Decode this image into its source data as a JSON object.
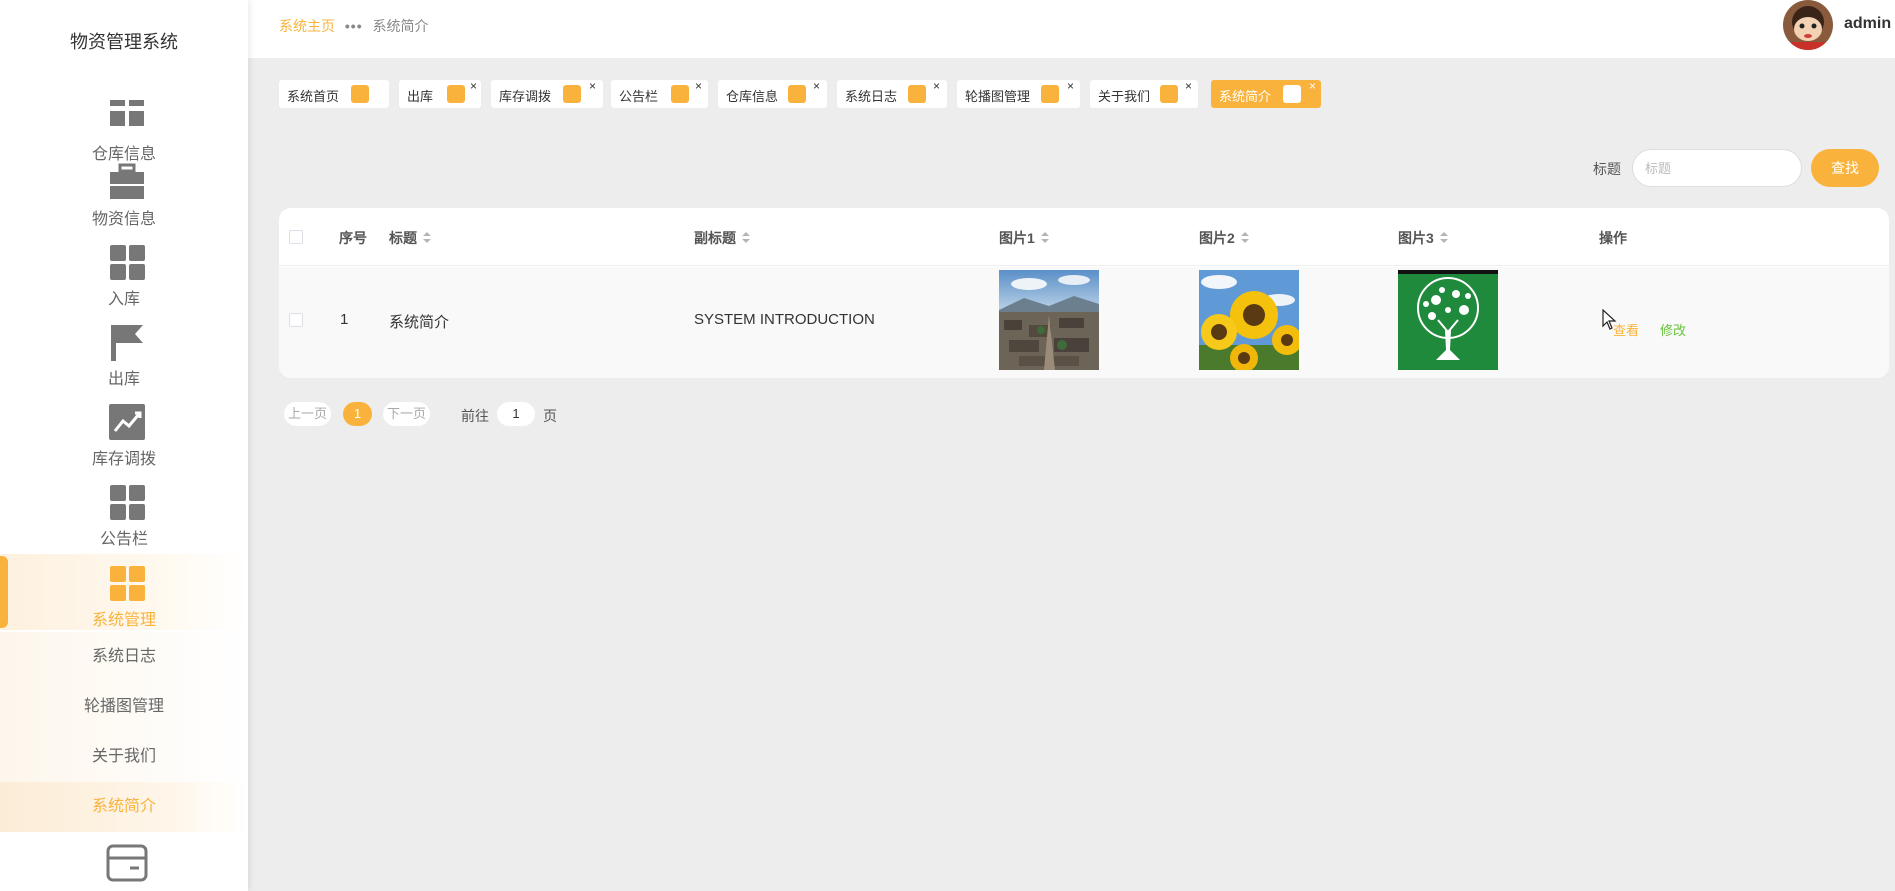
{
  "app": {
    "title": "物资管理系统"
  },
  "sidebar": {
    "items": [
      {
        "label": "仓库信息",
        "icon": "grid-icon"
      },
      {
        "label": "物资信息",
        "icon": "briefcase-icon"
      },
      {
        "label": "入库",
        "icon": "grid-icon"
      },
      {
        "label": "出库",
        "icon": "flag-icon"
      },
      {
        "label": "库存调拨",
        "icon": "chart-icon"
      },
      {
        "label": "公告栏",
        "icon": "grid-icon"
      },
      {
        "label": "系统管理",
        "icon": "grid-icon"
      }
    ],
    "subitems": [
      {
        "label": "系统日志"
      },
      {
        "label": "轮播图管理"
      },
      {
        "label": "关于我们"
      },
      {
        "label": "系统简介"
      }
    ]
  },
  "header": {
    "breadcrumb_home": "系统主页",
    "breadcrumb_dots": "•••",
    "breadcrumb_current": "系统简介",
    "username": "admin"
  },
  "tags": [
    {
      "label": "系统首页"
    },
    {
      "label": "出库"
    },
    {
      "label": "库存调拨"
    },
    {
      "label": "公告栏"
    },
    {
      "label": "仓库信息"
    },
    {
      "label": "系统日志"
    },
    {
      "label": "轮播图管理"
    },
    {
      "label": "关于我们"
    },
    {
      "label": "系统简介"
    }
  ],
  "tag_close": "×",
  "search": {
    "label": "标题",
    "placeholder": "标题",
    "button": "查找"
  },
  "table": {
    "headers": {
      "index": "序号",
      "title": "标题",
      "subtitle": "副标题",
      "pic1": "图片1",
      "pic2": "图片2",
      "pic3": "图片3",
      "ops": "操作"
    },
    "rows": [
      {
        "index": "1",
        "title": "系统简介",
        "subtitle": "SYSTEM INTRODUCTION",
        "view": "查看",
        "edit": "修改"
      }
    ]
  },
  "pagination": {
    "prev": "上一页",
    "current": "1",
    "next": "下一页",
    "goto": "前往",
    "page_value": "1",
    "page_unit": "页"
  },
  "colors": {
    "accent": "#f9b33c",
    "edit": "#67c23a",
    "background": "#ededed"
  }
}
